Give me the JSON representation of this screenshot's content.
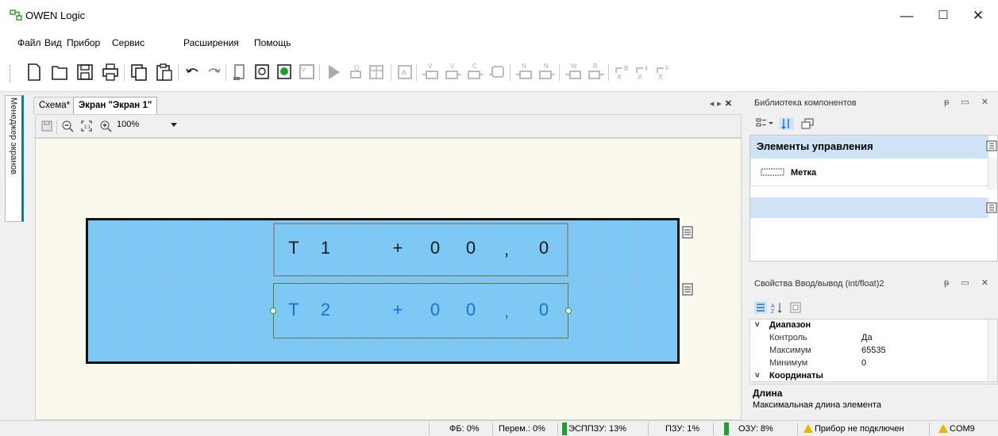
{
  "window": {
    "title": "OWEN Logic",
    "icon": "owen-logic-app-icon",
    "minimize": "—",
    "maximize": "☐",
    "close": "✕"
  },
  "menu": [
    "Файл",
    "Вид",
    "Прибор",
    "Сервис",
    "Расширения",
    "Помощь"
  ],
  "toolbar_icons": [
    "new-file-icon",
    "open-folder-icon",
    "save-icon",
    "print-icon",
    "copy-icon",
    "paste-icon",
    "undo-icon",
    "redo-icon",
    "device-icon",
    "info-icon",
    "device-settings-icon",
    "variables-icon",
    "run-icon",
    "debug-icon",
    "table-icon",
    "table-icon-2",
    "input-block-icon",
    "variable-block-icon",
    "constant-block-icon",
    "output-block-icon",
    "n-block-icon",
    "n-block-icon-2",
    "write-icon",
    "read-icon",
    "link-b-icon",
    "link-x-icon",
    "link-f-icon"
  ],
  "left_sidebar": {
    "tab_label": "Менеджер экранов"
  },
  "document": {
    "tabs": [
      {
        "label": "Схема*",
        "active": false
      },
      {
        "label": "Экран \"Экран 1\"",
        "active": true
      }
    ],
    "tab_controls": {
      "prev": "◂",
      "next": "▸",
      "close": "✕"
    },
    "zoom": "100%"
  },
  "lcd": {
    "line1": [
      "T",
      "1",
      "+",
      "0",
      "0",
      ",",
      "0"
    ],
    "line2": [
      "T",
      "2",
      "+",
      "0",
      "0",
      ",",
      "0"
    ],
    "background": "#7dc8f5",
    "text_color_line1": "#1a1a1a",
    "text_color_line2": "#1b6fe0"
  },
  "library_panel": {
    "title": "Библиотека компонентов",
    "controls": "ᵽ ▭ ✕",
    "group_title": "Элементы управления",
    "items": [
      "Метка"
    ]
  },
  "properties_panel": {
    "title": "Свойства Ввод/вывод (int/float)2",
    "controls": "ᵽ ▭ ✕",
    "rows": [
      {
        "type": "category",
        "name": "Диапазон"
      },
      {
        "type": "prop",
        "name": "Контроль",
        "value": "Да"
      },
      {
        "type": "prop",
        "name": "Максимум",
        "value": "65535"
      },
      {
        "type": "prop",
        "name": "Минимум",
        "value": "0"
      },
      {
        "type": "category",
        "name": "Координаты"
      }
    ],
    "description_title": "Длина",
    "description_text": "Максимальная длина элемента"
  },
  "status": {
    "fb": "ФБ: 0%",
    "vars": "Перем.: 0%",
    "eeprom": "ЭСППЗУ: 13%",
    "rom": "ПЗУ: 1%",
    "ram": "ОЗУ: 8%",
    "device": "Прибор не подключен",
    "port": "COM9"
  },
  "colors": {
    "accent_green": "#1f9e2f",
    "selection_blue": "#cfe3f7",
    "canvas": "#fbf9ee",
    "warning": "#e8b400"
  }
}
